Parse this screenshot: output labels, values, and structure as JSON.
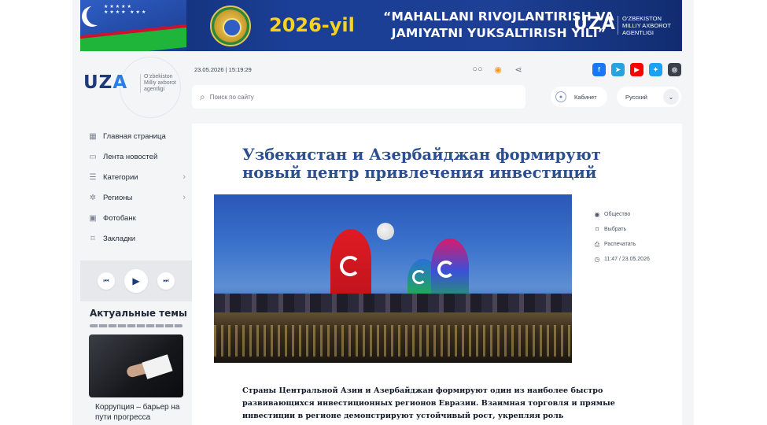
{
  "banner": {
    "year": "2026-yil",
    "slogan": "“MAHALLANI RIVOJLANTIRISH VA JAMIYATNI YUKSALTIRISH YILI”",
    "logo": "UZA",
    "logo_sub_1": "O‘ZBEKISTON",
    "logo_sub_2": "MILLIY AXBOROT",
    "logo_sub_3": "AGENTLIGI"
  },
  "site": {
    "logo_main": "UZ",
    "logo_accent": "A",
    "logo_sub_1": "O‘zbekiston",
    "logo_sub_2": "Milliy axborot",
    "logo_sub_3": "agentligi"
  },
  "header": {
    "datetime": "23.05.2026 | 15:19:29",
    "search_placeholder": "Поиск по сайту",
    "cabinet_label": "Кабинет",
    "language": "Русский",
    "tool_icons": [
      "glasses-icon",
      "rss-icon",
      "share-icon"
    ],
    "socials": [
      {
        "name": "facebook-icon",
        "glyph": "f",
        "color": "#1877f2"
      },
      {
        "name": "telegram-icon",
        "glyph": "➤",
        "color": "#2aa3dd"
      },
      {
        "name": "youtube-icon",
        "glyph": "▶",
        "color": "#ff0000"
      },
      {
        "name": "twitter-icon",
        "glyph": "✦",
        "color": "#1da1f2"
      },
      {
        "name": "instagram-icon",
        "glyph": "◎",
        "color": "#3a3f4b"
      }
    ]
  },
  "sidebar": {
    "items": [
      {
        "label": "Главная страница",
        "icon": "grid-icon",
        "has_arrow": false
      },
      {
        "label": "Лента новостей",
        "icon": "monitor-icon",
        "has_arrow": false
      },
      {
        "label": "Категории",
        "icon": "list-icon",
        "has_arrow": true
      },
      {
        "label": "Регионы",
        "icon": "map-icon",
        "has_arrow": true
      },
      {
        "label": "Фотобанк",
        "icon": "image-icon",
        "has_arrow": false
      },
      {
        "label": "Закладки",
        "icon": "bookmark-icon",
        "has_arrow": false
      }
    ],
    "topics_title": "Актуальные темы",
    "topic_caption": "Коррупция – барьер на пути прогресса"
  },
  "article": {
    "title": "Узбекистан и Азербайджан формируют новый центр привлечения инвестиций",
    "meta": {
      "category": "Общество",
      "bookmark": "Выбрать",
      "print": "Распечатать",
      "published": "11:47 / 23.05.2026"
    },
    "lead": "Страны Центральной Азии и Азербайджан формируют один из наиболее быстро развивающихся инвестиционных регионов Евразии. Взаимная торговля и прямые инвестиции в регионе демонстрируют устойчивый рост, укрепляя роль формирующегося инвестиционного коридора."
  }
}
